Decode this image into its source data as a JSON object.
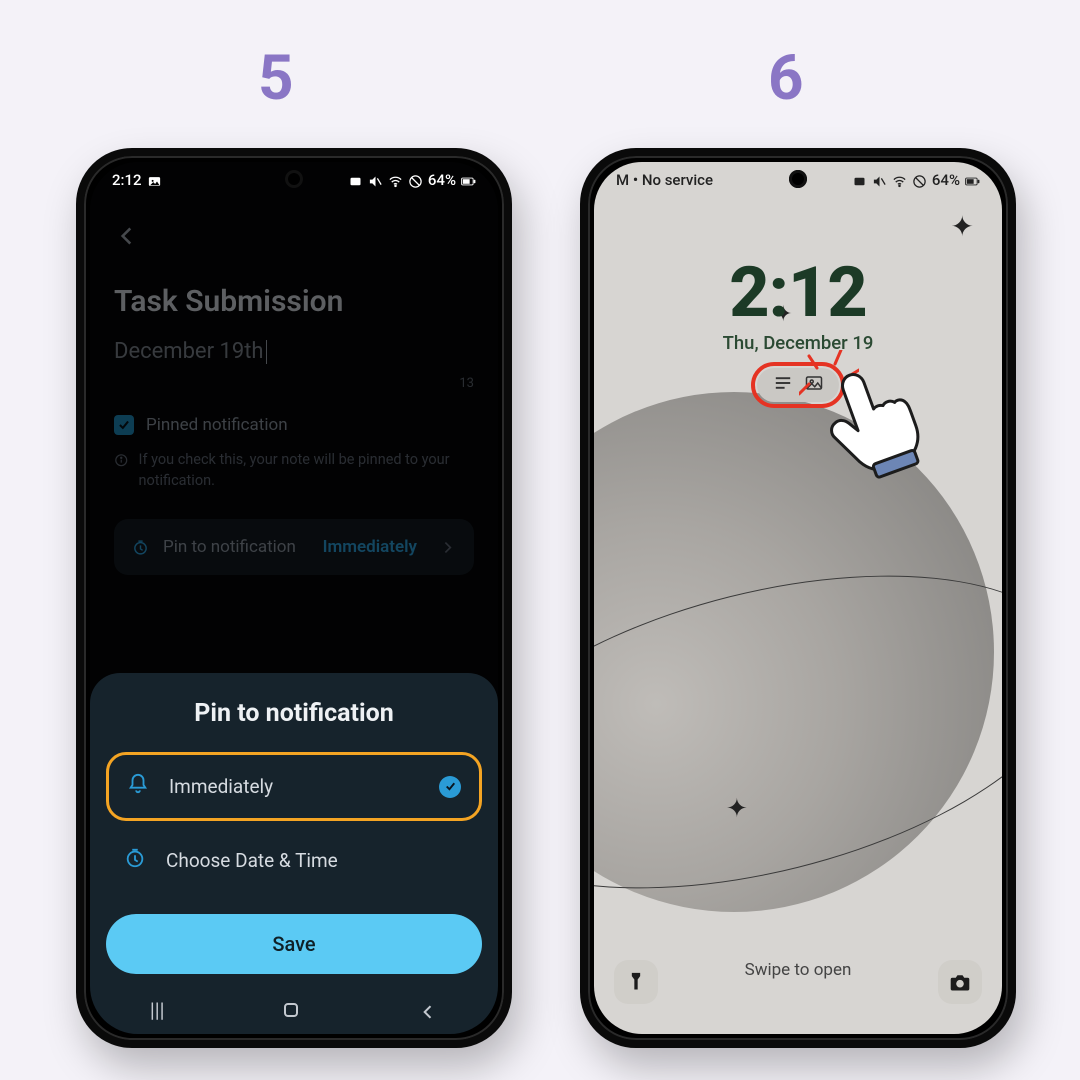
{
  "steps": {
    "one": "5",
    "two": "6"
  },
  "phone1": {
    "status": {
      "time": "2:12",
      "battery": "64%"
    },
    "title": "Task Submission",
    "date_text": "December 19th",
    "char_count": "13",
    "pinned_label": "Pinned notification",
    "pinned_help": "If you check this, your note will be pinned to your notification.",
    "pin_row_label": "Pin to notification",
    "pin_row_value": "Immediately",
    "sheet": {
      "title": "Pin to notification",
      "option1": "Immediately",
      "option2": "Choose Date & Time",
      "save": "Save"
    }
  },
  "phone2": {
    "status": {
      "carrier": "M • No service",
      "battery": "64%"
    },
    "time": "2:12",
    "date": "Thu, December 19",
    "swipe": "Swipe to open"
  }
}
